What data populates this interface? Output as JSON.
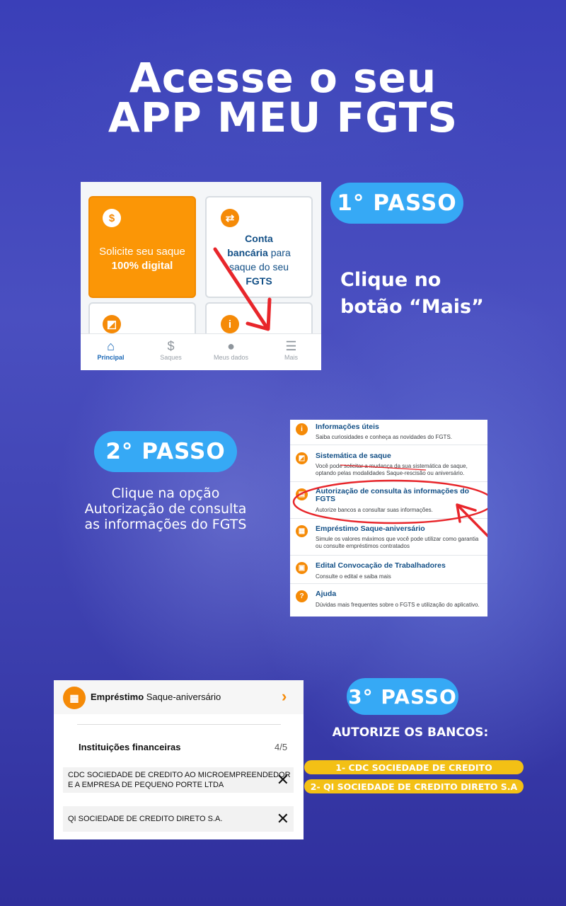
{
  "headline": {
    "line1": "Acesse o seu",
    "line2": "APP MEU FGTS"
  },
  "step1": {
    "badge": "1° PASSO",
    "instruction_line1": "Clique no",
    "instruction_line2": "botão “Mais”",
    "screenshot": {
      "card_saque_line1": "Solicite seu saque",
      "card_saque_line2": "100% digital",
      "card_conta_line1": "Conta",
      "card_conta_bold": "bancária",
      "card_conta_rest": " para",
      "card_conta_line3": "saque do seu",
      "card_conta_line4": "FGTS",
      "nav": [
        {
          "label": "Principal",
          "icon": "home-icon"
        },
        {
          "label": "Saques",
          "icon": "dollar-icon"
        },
        {
          "label": "Meus dados",
          "icon": "user-icon"
        },
        {
          "label": "Mais",
          "icon": "menu-icon"
        }
      ]
    }
  },
  "step2": {
    "badge": "2° PASSO",
    "instruction_line1": "Clique na opção",
    "instruction_line2": "Autorização de consulta",
    "instruction_line3": "as informações do FGTS",
    "menu": [
      {
        "title": "Informações úteis",
        "desc": "Saiba curiosidades e conheça as novidades do FGTS."
      },
      {
        "title": "Sistemática de saque",
        "desc": "Você pode solicitar a mudança da sua sistemática de saque, optando pelas modalidades Saque-rescisão ou aniversário."
      },
      {
        "title": "Autorização de consulta às informações do FGTS",
        "desc": "Autorize bancos a consultar suas informações."
      },
      {
        "title": "Empréstimo Saque-aniversário",
        "desc": "Simule os valores máximos que você pode utilizar como garantia ou consulte empréstimos contratados"
      },
      {
        "title": "Edital Convocação de Trabalhadores",
        "desc": "Consulte o edital e saiba mais"
      },
      {
        "title": "Ajuda",
        "desc": "Dúvidas mais frequentes sobre o FGTS e utilização do aplicativo."
      }
    ]
  },
  "step3": {
    "badge": "3° PASSO",
    "instruction": "AUTORIZE OS BANCOS:",
    "banks": [
      "1- CDC SOCIEDADE DE CREDITO",
      "2- QI SOCIEDADE DE CREDITO DIRETO S.A"
    ],
    "screenshot": {
      "header_bold": "Empréstimo",
      "header_rest": " Saque-aniversário",
      "section_title": "Instituições financeiras",
      "count": "4/5",
      "institutions": [
        {
          "line1": "CDC SOCIEDADE DE CREDITO AO MICROEMPREENDEDOR",
          "line2": "E A EMPRESA DE PEQUENO PORTE LTDA"
        },
        {
          "line1": "QI SOCIEDADE DE CREDITO DIRETO S.A.",
          "line2": ""
        }
      ]
    }
  },
  "colors": {
    "badge_blue": "#36a9f5",
    "caixa_orange": "#f58a07",
    "bank_yellow": "#f3c015",
    "annotation_red": "#e8262b"
  }
}
